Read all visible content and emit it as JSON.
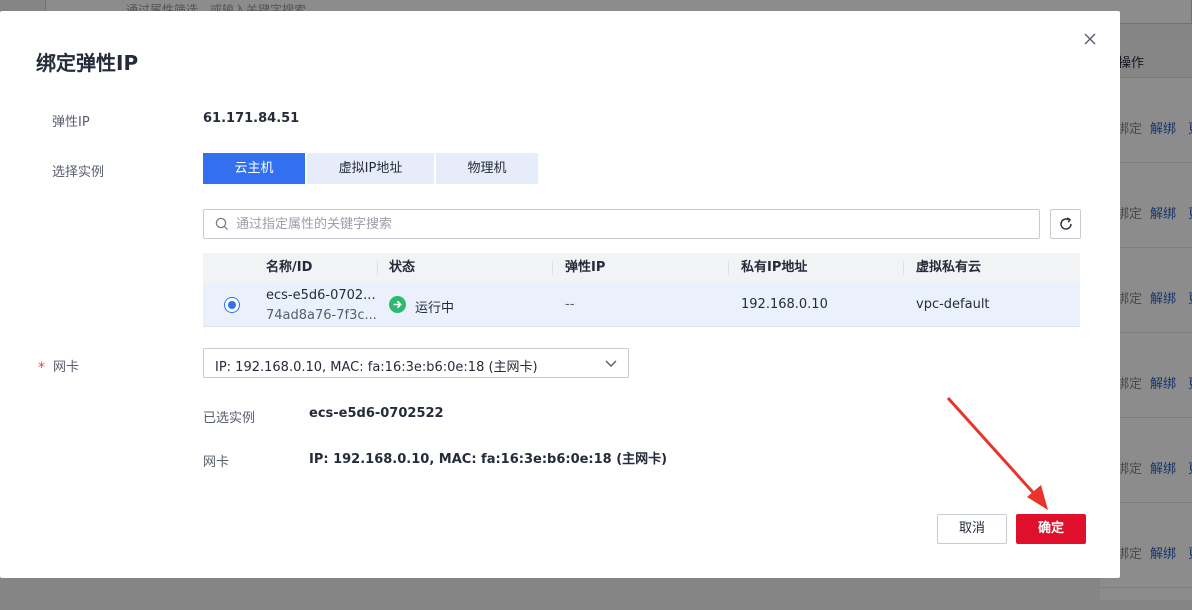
{
  "background": {
    "search_placeholder": "通过属性筛选，或输入关键字搜索",
    "column_header": "操作",
    "row_actions": [
      {
        "unbind_disabled": "绑定",
        "unbind": "解绑",
        "more": "更"
      },
      {
        "unbind_disabled": "绑定",
        "unbind": "解绑",
        "more": "更"
      },
      {
        "unbind_disabled": "绑定",
        "unbind": "解绑",
        "more": "更"
      },
      {
        "unbind_disabled": "绑定",
        "unbind": "解绑",
        "more": "更"
      },
      {
        "unbind_disabled": "绑定",
        "unbind": "解绑",
        "more": "更"
      },
      {
        "unbind_disabled": "绑定",
        "unbind": "解绑",
        "more": "更"
      }
    ]
  },
  "dialog": {
    "title": "绑定弹性IP",
    "eip_label": "弹性IP",
    "eip_value": "61.171.84.51",
    "instance_label": "选择实例",
    "tabs": [
      {
        "label": "云主机",
        "active": true
      },
      {
        "label": "虚拟IP地址",
        "active": false
      },
      {
        "label": "物理机",
        "active": false
      }
    ],
    "search_placeholder": "通过指定属性的关键字搜索",
    "table": {
      "columns": [
        "名称/ID",
        "状态",
        "弹性IP",
        "私有IP地址",
        "虚拟私有云"
      ],
      "rows": [
        {
          "name": "ecs-e5d6-0702...",
          "id": "74ad8a76-7f3c...",
          "status": "运行中",
          "eip": "--",
          "private_ip": "192.168.0.10",
          "vpc": "vpc-default",
          "selected": true
        }
      ]
    },
    "nic_required_mark": "*",
    "nic_label": "网卡",
    "nic_select_value": "IP: 192.168.0.10, MAC: fa:16:3e:b6:0e:18 (主网卡)",
    "selected_instance_label": "已选实例",
    "selected_instance_value": "ecs-e5d6-0702522",
    "selected_nic_label": "网卡",
    "selected_nic_value": "IP: 192.168.0.10, MAC: fa:16:3e:b6:0e:18 (主网卡)",
    "cancel_label": "取消",
    "confirm_label": "确定"
  },
  "colors": {
    "primary": "#3370ef",
    "confirm": "#e0102d",
    "running": "#2eb872",
    "annotation_arrow": "#e8342b"
  }
}
